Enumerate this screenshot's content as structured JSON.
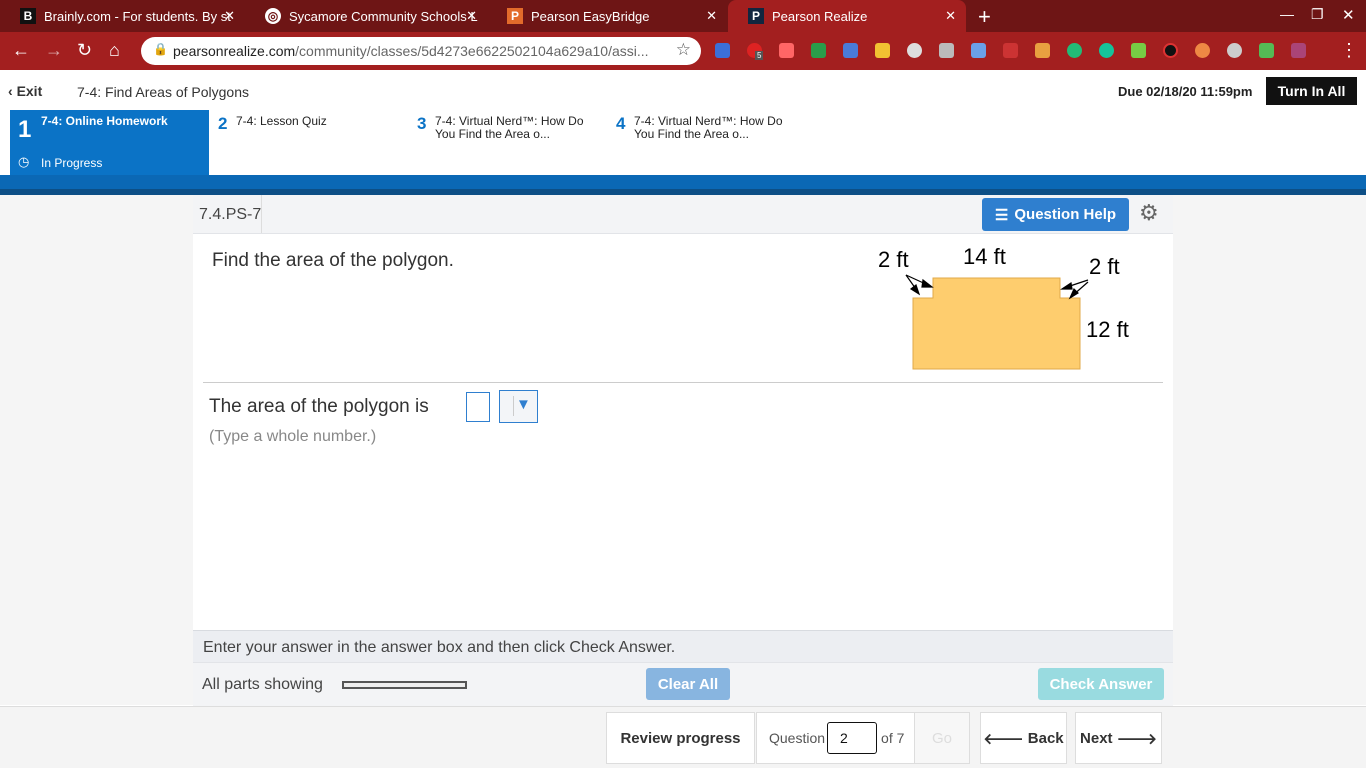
{
  "browser": {
    "tabs": [
      {
        "title": "Brainly.com - For students. By st",
        "icon": "brainly-icon"
      },
      {
        "title": "Sycamore Community Schools L",
        "icon": "globe-icon"
      },
      {
        "title": "Pearson EasyBridge",
        "icon": "pearson-icon"
      },
      {
        "title": "Pearson Realize",
        "icon": "pearson-icon",
        "active": true
      }
    ],
    "url_host": "pearsonrealize.com",
    "url_path": "/community/classes/5d4273e6622502104a629a10/assi...",
    "ext_badge": "5"
  },
  "header": {
    "exit": "Exit",
    "title": "7-4: Find Areas of Polygons",
    "due": "Due 02/18/20 11:59pm",
    "turn_in": "Turn In All"
  },
  "assignments": [
    {
      "num": "1",
      "title": "7-4: Online Homework",
      "status": "In Progress"
    },
    {
      "num": "2",
      "title": "7-4: Lesson Quiz"
    },
    {
      "num": "3",
      "title": "7-4: Virtual Nerd™: How Do You Find the Area o..."
    },
    {
      "num": "4",
      "title": "7-4: Virtual Nerd™: How Do You Find the Area o..."
    }
  ],
  "question": {
    "id": "7.4.PS-7",
    "help": "Question Help",
    "prompt": "Find the area of the polygon.",
    "figure": {
      "top": "14 ft",
      "left_notch": "2 ft",
      "right_notch": "2 ft",
      "height": "12 ft",
      "fill": "#fecd6e"
    },
    "answer_prefix": "The area of the polygon is",
    "hint": "(Type a whole number.)",
    "instruction": "Enter your answer in the answer box and then click Check Answer.",
    "parts": "All parts showing",
    "clear": "Clear All",
    "check": "Check Answer"
  },
  "nav": {
    "review": "Review progress",
    "question_label": "Question",
    "question_value": "2",
    "of": "of 7",
    "go": "Go",
    "back": "Back",
    "next": "Next"
  }
}
